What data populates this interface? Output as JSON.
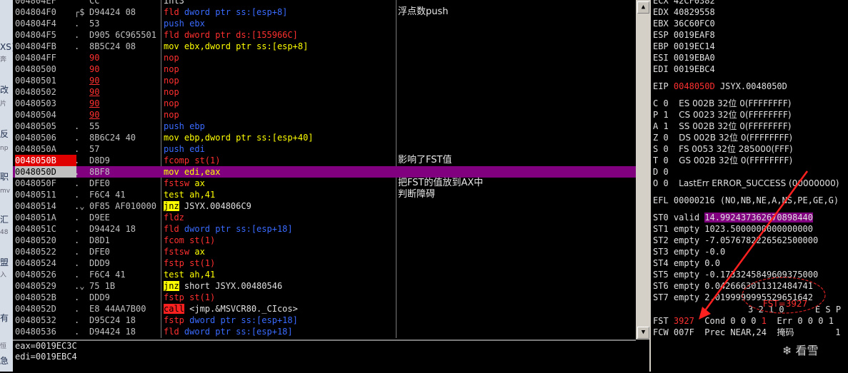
{
  "left_strip": [
    "XS}",
    "奔",
    "改",
    "片",
    "反",
    "np",
    "职",
    "mv",
    "汇",
    "48",
    "盟",
    "入",
    "有",
    "恒",
    "急"
  ],
  "disasm": [
    {
      "addr": "004804EF",
      "mark": "",
      "hex": "CC",
      "asm": [
        {
          "t": "int3",
          "c": "k-white"
        }
      ],
      "cmt": ""
    },
    {
      "addr": "004804F0",
      "mark": "┌$",
      "hex": "D94424 08",
      "asm": [
        {
          "t": "fld ",
          "c": "k-red"
        },
        {
          "t": "dword ptr ss:[esp+8]",
          "c": "k-blue"
        }
      ],
      "cmt": "浮点数push"
    },
    {
      "addr": "004804F4",
      "mark": ".",
      "hex": "53",
      "asm": [
        {
          "t": "push ebx",
          "c": "k-blue"
        }
      ],
      "cmt": ""
    },
    {
      "addr": "004804F5",
      "mark": ".",
      "hex": "D905 6C965501",
      "asm": [
        {
          "t": "fld ",
          "c": "k-red"
        },
        {
          "t": "dword ptr ds:[155966C]",
          "c": "k-red"
        }
      ],
      "cmt": ""
    },
    {
      "addr": "004804FB",
      "mark": ".",
      "hex": "8B5C24 08",
      "asm": [
        {
          "t": "mov ebx,dword ptr ss:[esp+8]",
          "c": "k-yellow"
        }
      ],
      "cmt": ""
    },
    {
      "addr": "004804FF",
      "mark": "",
      "hex": "90",
      "hexc": "red",
      "asm": [
        {
          "t": "nop",
          "c": "k-red"
        }
      ],
      "cmt": ""
    },
    {
      "addr": "00480500",
      "mark": "",
      "hex": "90",
      "hexc": "red",
      "asm": [
        {
          "t": "nop",
          "c": "k-red"
        }
      ],
      "cmt": ""
    },
    {
      "addr": "00480501",
      "mark": "",
      "hex": "90",
      "hexc": "red uline",
      "asm": [
        {
          "t": "nop",
          "c": "k-red"
        }
      ],
      "cmt": ""
    },
    {
      "addr": "00480502",
      "mark": "",
      "hex": "90",
      "hexc": "red uline",
      "asm": [
        {
          "t": "nop",
          "c": "k-red"
        }
      ],
      "cmt": ""
    },
    {
      "addr": "00480503",
      "mark": "",
      "hex": "90",
      "hexc": "red uline",
      "asm": [
        {
          "t": "nop",
          "c": "k-red"
        }
      ],
      "cmt": ""
    },
    {
      "addr": "00480504",
      "mark": "",
      "hex": "90",
      "hexc": "red uline",
      "asm": [
        {
          "t": "nop",
          "c": "k-red"
        }
      ],
      "cmt": ""
    },
    {
      "addr": "00480505",
      "mark": ".",
      "hex": "55",
      "asm": [
        {
          "t": "push ebp",
          "c": "k-blue"
        }
      ],
      "cmt": ""
    },
    {
      "addr": "00480506",
      "mark": ".",
      "hex": "8B6C24 40",
      "asm": [
        {
          "t": "mov ebp,dword ptr ss:[esp+40]",
          "c": "k-yellow"
        }
      ],
      "cmt": ""
    },
    {
      "addr": "0048050A",
      "mark": ".",
      "hex": "57",
      "asm": [
        {
          "t": "push edi",
          "c": "k-blue"
        }
      ],
      "cmt": ""
    },
    {
      "addr": "0048050B",
      "mark": ".",
      "hex": "D8D9",
      "addrc": "bp",
      "asm": [
        {
          "t": "fcomp st(1)",
          "c": "k-red"
        }
      ],
      "cmt": "影响了FST值"
    },
    {
      "addr": "0048050D",
      "mark": ".",
      "hex": "8BF8",
      "addrc": "cur",
      "eip": true,
      "asm": [
        {
          "t": "mov edi,eax",
          "c": "k-yellow"
        }
      ],
      "cmt": ""
    },
    {
      "addr": "0048050F",
      "mark": ".",
      "hex": "DFE0",
      "asm": [
        {
          "t": "fstsw ",
          "c": "k-red"
        },
        {
          "t": "ax",
          "c": "k-yellow"
        }
      ],
      "cmt": "把FST的值放到AX中"
    },
    {
      "addr": "00480511",
      "mark": ".",
      "hex": "F6C4 41",
      "asm": [
        {
          "t": "test ah,41",
          "c": "k-yellow"
        }
      ],
      "cmt": "判断障碍"
    },
    {
      "addr": "00480514",
      "mark": ".⌄",
      "hex": "0F85 AF010000",
      "asm": [
        {
          "t": "jnz",
          "c": "hl-yellow"
        },
        {
          "t": " JSYX.004806C9",
          "c": "k-white"
        }
      ],
      "cmt": ""
    },
    {
      "addr": "0048051A",
      "mark": ".",
      "hex": "D9EE",
      "asm": [
        {
          "t": "fldz",
          "c": "k-red"
        }
      ],
      "cmt": ""
    },
    {
      "addr": "0048051C",
      "mark": ".",
      "hex": "D94424 18",
      "asm": [
        {
          "t": "fld ",
          "c": "k-red"
        },
        {
          "t": "dword ptr ss:[esp+18]",
          "c": "k-blue"
        }
      ],
      "cmt": ""
    },
    {
      "addr": "00480520",
      "mark": ".",
      "hex": "D8D1",
      "asm": [
        {
          "t": "fcom st(1)",
          "c": "k-red"
        }
      ],
      "cmt": ""
    },
    {
      "addr": "00480522",
      "mark": ".",
      "hex": "DFE0",
      "asm": [
        {
          "t": "fstsw ",
          "c": "k-red"
        },
        {
          "t": "ax",
          "c": "k-yellow"
        }
      ],
      "cmt": ""
    },
    {
      "addr": "00480524",
      "mark": ".",
      "hex": "DDD9",
      "asm": [
        {
          "t": "fstp st(1)",
          "c": "k-red"
        }
      ],
      "cmt": ""
    },
    {
      "addr": "00480526",
      "mark": ".",
      "hex": "F6C4 41",
      "asm": [
        {
          "t": "test ah,41",
          "c": "k-yellow"
        }
      ],
      "cmt": ""
    },
    {
      "addr": "00480529",
      "mark": ".⌄",
      "hex": "75 1B",
      "asm": [
        {
          "t": "jnz",
          "c": "hl-yellow"
        },
        {
          "t": " short JSYX.00480546",
          "c": "k-white"
        }
      ],
      "cmt": ""
    },
    {
      "addr": "0048052B",
      "mark": ".",
      "hex": "DDD9",
      "asm": [
        {
          "t": "fstp st(1)",
          "c": "k-red"
        }
      ],
      "cmt": ""
    },
    {
      "addr": "0048052D",
      "mark": ".",
      "hex": "E8 44AA7B00",
      "asm": [
        {
          "t": "call",
          "c": "hl-red"
        },
        {
          "t": " <jmp.&MSVCR80._CIcos>",
          "c": "k-white"
        }
      ],
      "cmt": ""
    },
    {
      "addr": "00480532",
      "mark": ".",
      "hex": "D95C24 18",
      "asm": [
        {
          "t": "fstp ",
          "c": "k-red"
        },
        {
          "t": "dword ptr ss:[esp+18]",
          "c": "k-blue"
        }
      ],
      "cmt": ""
    },
    {
      "addr": "00480536",
      "mark": ".",
      "hex": "D94424 18",
      "asm": [
        {
          "t": "fld ",
          "c": "k-red"
        },
        {
          "t": "dword ptr ss:[esp+18]",
          "c": "k-blue"
        }
      ],
      "cmt": ""
    }
  ],
  "info": [
    "eax=0019EC3C",
    "edi=0019EBC4"
  ],
  "registers": {
    "top": [
      {
        "n": "ECX",
        "v": "42CF0382"
      },
      {
        "n": "EDX",
        "v": "40829558"
      },
      {
        "n": "EBX",
        "v": "36C60FC0"
      },
      {
        "n": "ESP",
        "v": "0019EAF8"
      },
      {
        "n": "EBP",
        "v": "0019EC14"
      },
      {
        "n": "ESI",
        "v": "0019EBA0"
      },
      {
        "n": "EDI",
        "v": "0019EBC4"
      }
    ],
    "eip": {
      "n": "EIP",
      "v": "0048050D",
      "tail": "JSYX.0048050D"
    },
    "segs": [
      {
        "f": "C 0",
        "s": "ES 002B 32位 0(FFFFFFFF)"
      },
      {
        "f": "P 1",
        "s": "CS 0023 32位 0(FFFFFFFF)"
      },
      {
        "f": "A 1",
        "s": "SS 002B 32位 0(FFFFFFFF)"
      },
      {
        "f": "Z 0",
        "s": "DS 002B 32位 0(FFFFFFFF)"
      },
      {
        "f": "S 0",
        "s": "FS 0053 32位 285000(FFF)"
      },
      {
        "f": "T 0",
        "s": "GS 002B 32位 0(FFFFFFFF)"
      },
      {
        "f": "D 0",
        "s": ""
      },
      {
        "f": "O 0",
        "s": "LastErr ERROR_SUCCESS (00000000)"
      }
    ],
    "efl": "EFL 00000216 (NO,NB,NE,A,NS,PE,GE,G)",
    "st": [
      {
        "n": "ST0",
        "tag": "valid",
        "v": "14.992437362670898440"
      },
      {
        "n": "ST1",
        "tag": "empty",
        "v": "1023.5000000000000000"
      },
      {
        "n": "ST2",
        "tag": "empty",
        "v": "-7.0576782226562500000"
      },
      {
        "n": "ST3",
        "tag": "empty",
        "v": "-0.0"
      },
      {
        "n": "ST4",
        "tag": "empty",
        "v": "0.0"
      },
      {
        "n": "ST5",
        "tag": "empty",
        "v": "-0.1733245849609375000"
      },
      {
        "n": "ST6",
        "tag": "empty",
        "v": "0.0426663011312484741"
      },
      {
        "n": "ST7",
        "tag": "empty",
        "v": "2.0199999995529651642"
      }
    ],
    "flagsHdr": "3 2 1 0      E S P",
    "fst": {
      "label": "FST",
      "val": "3927",
      "cond": "Cond 0 0 0",
      "cbit": "1",
      "err": "Err 0 0 0 1"
    },
    "fcw": {
      "label": "FCW",
      "val": "007F",
      "prec": "Prec NEAR,24",
      "mask": "掩码",
      "last": "1"
    }
  },
  "annotation": "FST=3927",
  "watermark": "看雪",
  "scroll": {
    "up": "▲",
    "down": "▼"
  }
}
